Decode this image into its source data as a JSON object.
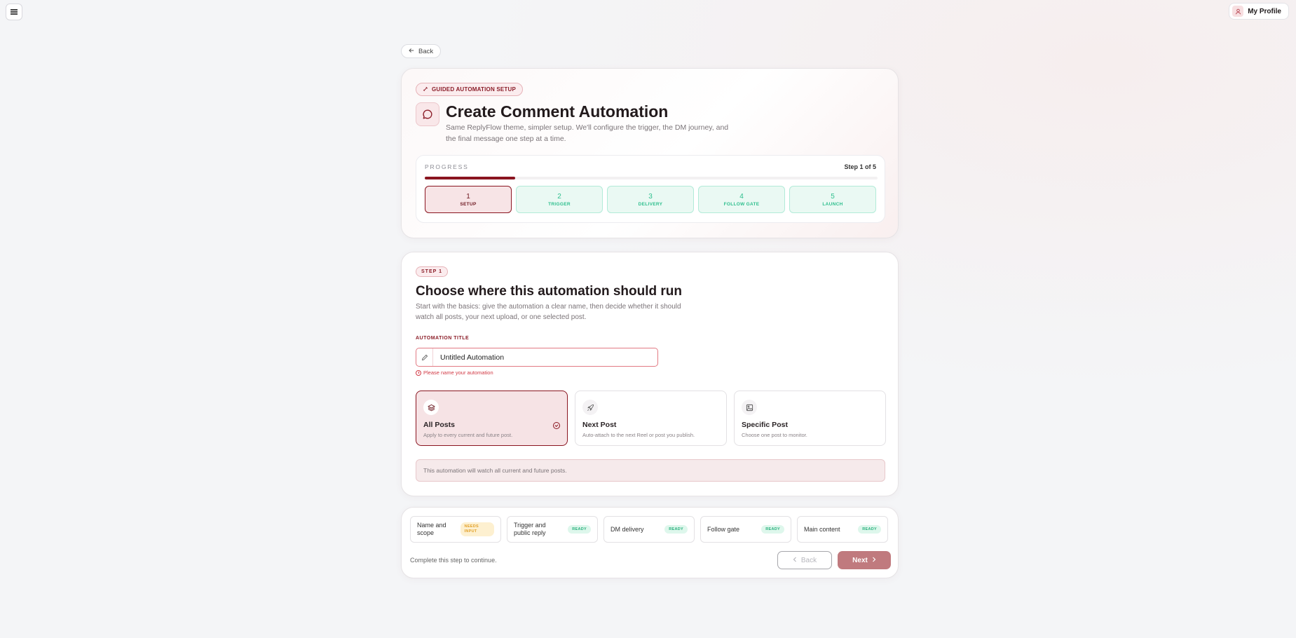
{
  "topbar": {
    "profile_label": "My Profile"
  },
  "nav": {
    "back_label": "Back"
  },
  "hero": {
    "badge": "GUIDED AUTOMATION SETUP",
    "title": "Create Comment Automation",
    "subtitle": "Same ReplyFlow theme, simpler setup. We'll configure the trigger, the DM journey, and the final message one step at a time."
  },
  "progress": {
    "label": "PROGRESS",
    "step_text": "Step 1 of 5",
    "fraction": 0.2,
    "steps": [
      {
        "num": "1",
        "label": "SETUP",
        "active": true
      },
      {
        "num": "2",
        "label": "TRIGGER",
        "active": false
      },
      {
        "num": "3",
        "label": "DELIVERY",
        "active": false
      },
      {
        "num": "4",
        "label": "FOLLOW GATE",
        "active": false
      },
      {
        "num": "5",
        "label": "LAUNCH",
        "active": false
      }
    ]
  },
  "step": {
    "badge": "STEP 1",
    "title": "Choose where this automation should run",
    "subtitle": "Start with the basics: give the automation a clear name, then decide whether it should watch all posts, your next upload, or one selected post.",
    "field_label": "AUTOMATION TITLE",
    "title_value": "Untitled Automation",
    "error": "Please name your automation",
    "options": [
      {
        "title": "All Posts",
        "desc": "Apply to every current and future post.",
        "icon": "layers-icon",
        "selected": true
      },
      {
        "title": "Next Post",
        "desc": "Auto-attach to the next Reel or post you publish.",
        "icon": "rocket-icon",
        "selected": false
      },
      {
        "title": "Specific Post",
        "desc": "Choose one post to monitor.",
        "icon": "image-icon",
        "selected": false
      }
    ],
    "note": "This automation will watch all current and future posts."
  },
  "footer": {
    "checklist": [
      {
        "label": "Name and scope",
        "status": "NEEDS INPUT",
        "state": "warn"
      },
      {
        "label": "Trigger and public reply",
        "status": "READY",
        "state": "ready"
      },
      {
        "label": "DM delivery",
        "status": "READY",
        "state": "ready"
      },
      {
        "label": "Follow gate",
        "status": "READY",
        "state": "ready"
      },
      {
        "label": "Main content",
        "status": "READY",
        "state": "ready"
      }
    ],
    "hint": "Complete this step to continue.",
    "back_label": "Back",
    "next_label": "Next"
  }
}
